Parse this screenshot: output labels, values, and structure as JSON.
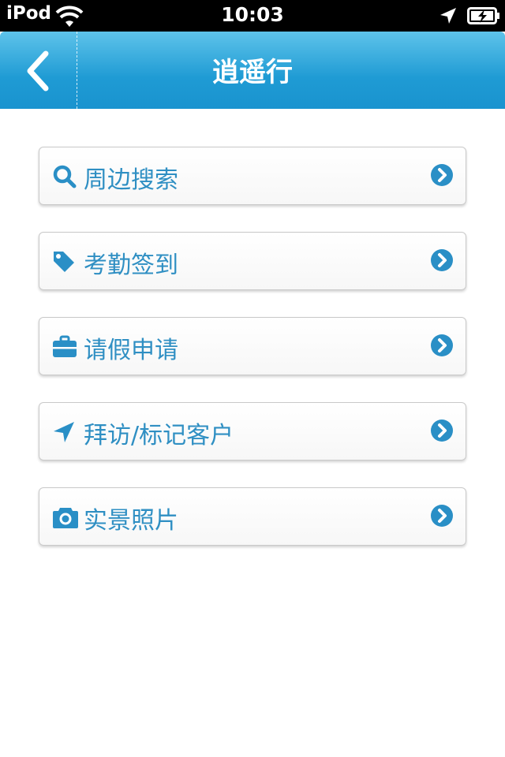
{
  "status_bar": {
    "carrier": "iPod",
    "time": "10:03",
    "icons": [
      "wifi-icon",
      "location-arrow-icon",
      "battery-charging-icon"
    ]
  },
  "nav": {
    "title": "逍遥行",
    "back_icon": "chevron-left-icon"
  },
  "menu": {
    "items": [
      {
        "label": "周边搜索",
        "icon": "search-icon"
      },
      {
        "label": "考勤签到",
        "icon": "tag-icon"
      },
      {
        "label": "请假申请",
        "icon": "briefcase-icon"
      },
      {
        "label": "拜访/标记客户",
        "icon": "location-arrow-icon"
      },
      {
        "label": "实景照片",
        "icon": "camera-icon"
      }
    ],
    "chevron_icon": "chevron-right-circle-icon"
  },
  "colors": {
    "accent": "#1f9bd4",
    "label": "#2f8fc3",
    "icon": "#2a8fc6"
  }
}
